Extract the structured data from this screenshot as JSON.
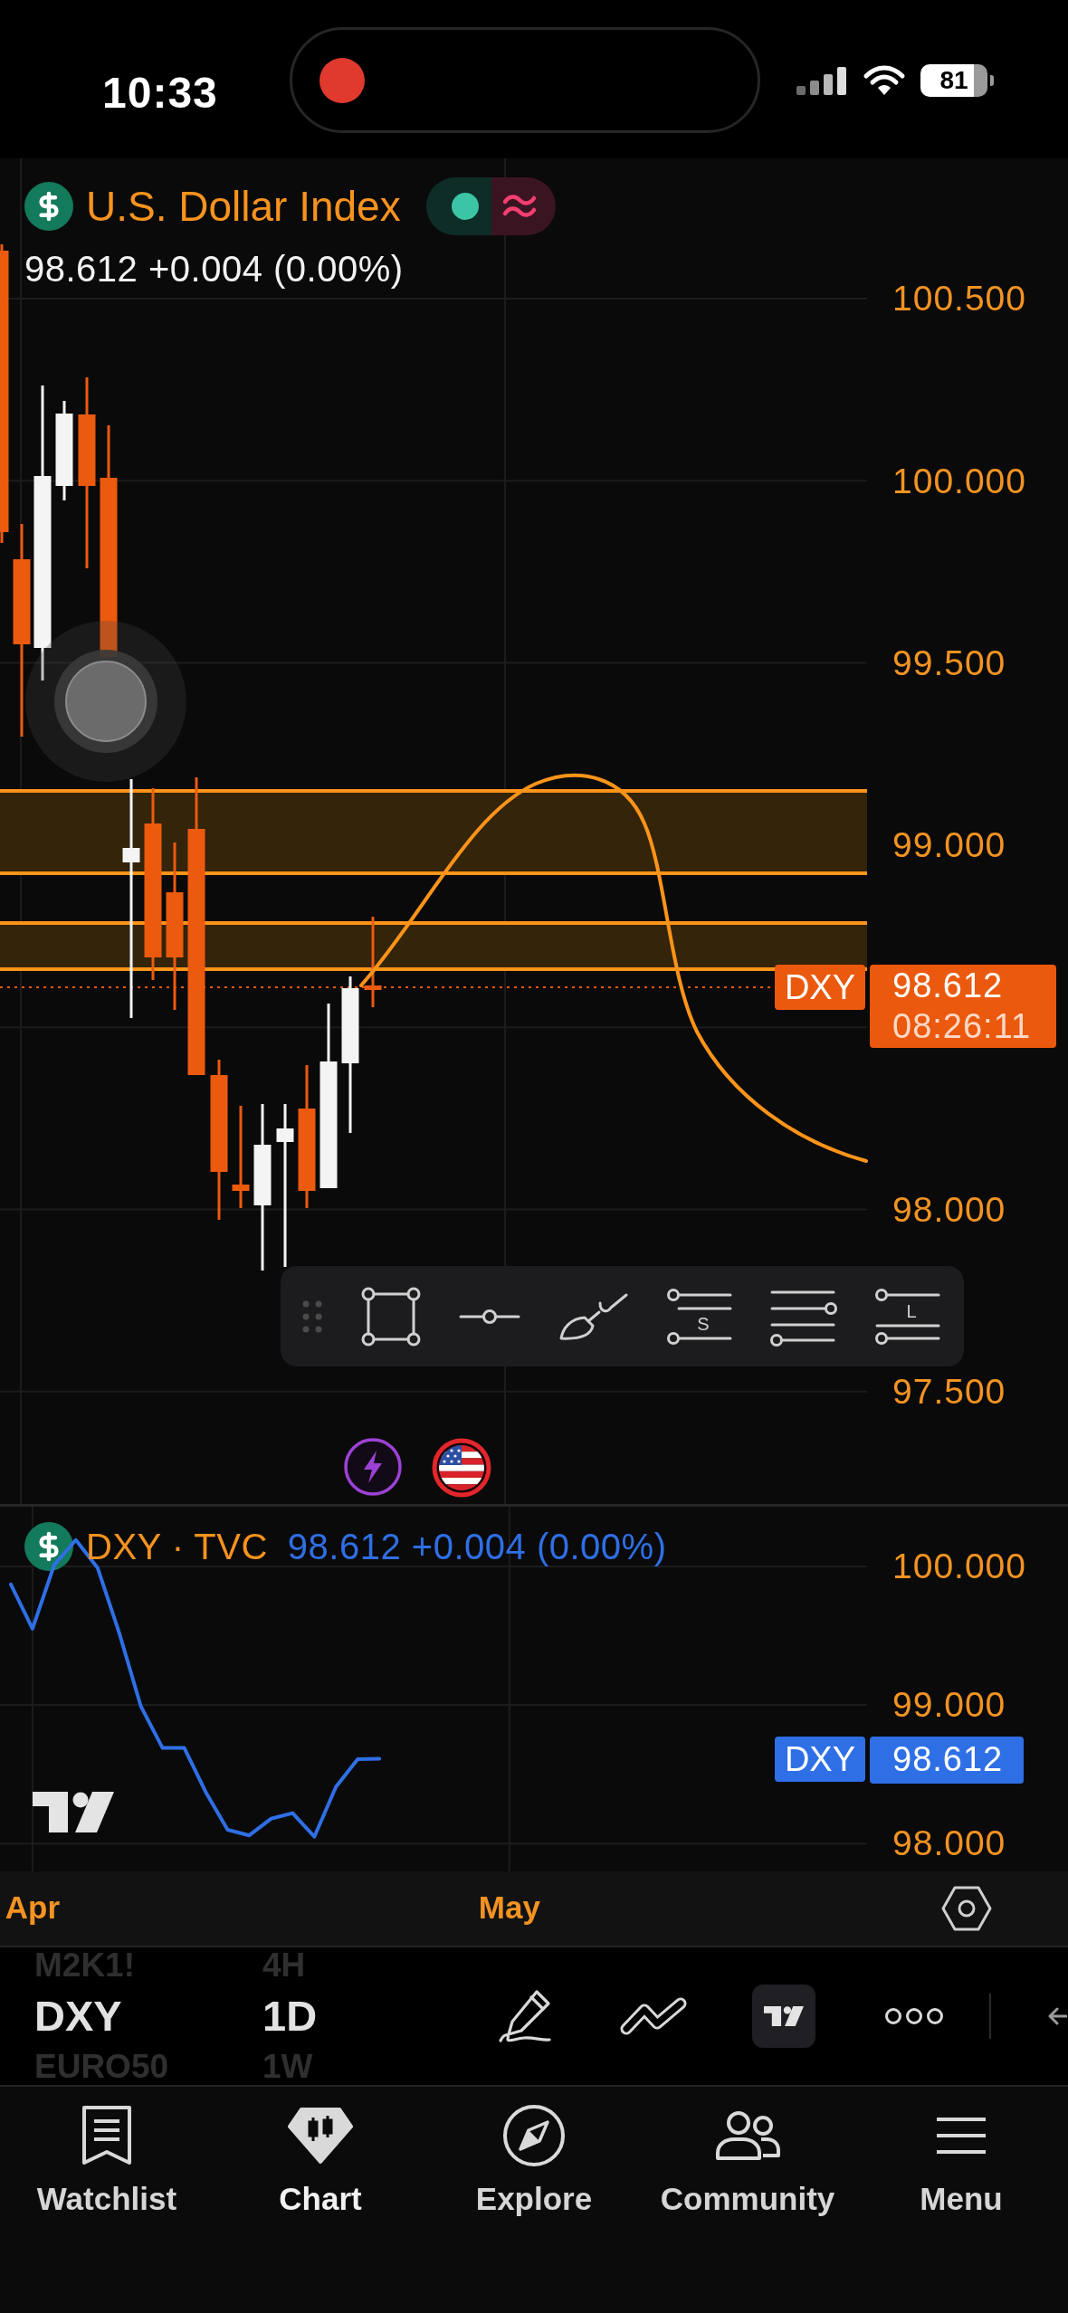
{
  "status_bar": {
    "time": "10:33",
    "battery": "81"
  },
  "main_chart": {
    "legend": {
      "title": "U.S. Dollar Index",
      "quote": "98.612 +0.004 (0.00%)"
    },
    "price_scale": [
      "100.500",
      "100.000",
      "99.500",
      "99.000",
      "98.000",
      "97.500"
    ],
    "price_tag": {
      "symbol": "DXY",
      "price": "98.612",
      "countdown": "08:26:11"
    },
    "drawing_toolbar": {
      "letters": [
        "S",
        "L"
      ]
    }
  },
  "compare_pane": {
    "legend": {
      "symbol": "DXY · TVC",
      "quote": "98.612 +0.004 (0.00%)"
    },
    "price_tag": {
      "price": "98.612"
    },
    "chart_data": {
      "type": "line",
      "grid": true,
      "categories": [
        null,
        "Apr",
        null,
        null,
        null,
        null,
        null,
        null,
        null,
        null,
        null,
        null,
        null,
        null,
        null,
        null,
        null,
        null,
        null,
        null,
        null,
        null,
        null,
        "May",
        null,
        null,
        null,
        null,
        null,
        null,
        null,
        null,
        null,
        null,
        null,
        null,
        null,
        null,
        null,
        null
      ],
      "series": [
        {
          "name": "DXY",
          "color": "#2f6fe6",
          "values": [
            99.87,
            99.55,
            100.01,
            100.19,
            99.99,
            99.52,
            98.99,
            98.69,
            98.69,
            98.37,
            98.1,
            98.06,
            98.18,
            98.22,
            98.05,
            98.41,
            98.61,
            98.612,
            null,
            null,
            null,
            null,
            null,
            null,
            null,
            null,
            null,
            null,
            null,
            null,
            null,
            null,
            null,
            null,
            null,
            null,
            null,
            null,
            null,
            null
          ]
        }
      ],
      "ylim": [
        97.8,
        100.43
      ],
      "yticks": [
        {
          "value": 100,
          "label": "100.000"
        },
        {
          "value": 99,
          "label": "99.000"
        },
        {
          "value": 98,
          "label": "98.000"
        }
      ]
    }
  },
  "toolbar": {
    "symbols": [
      {
        "label": "M2K1!",
        "selected": false
      },
      {
        "label": "DXY",
        "selected": true
      },
      {
        "label": "EURO50",
        "selected": false
      }
    ],
    "intervals": [
      {
        "label": "4H",
        "selected": false
      },
      {
        "label": "1D",
        "selected": true
      },
      {
        "label": "1W",
        "selected": false
      }
    ],
    "tools": [
      {
        "selected": false
      },
      {
        "selected": false
      },
      {
        "selected": true
      },
      {
        "selected": false
      }
    ]
  },
  "tab_bar": [
    {
      "label": "Watchlist",
      "selected": false
    },
    {
      "label": "Chart",
      "selected": true
    },
    {
      "label": "Explore",
      "selected": false
    },
    {
      "label": "Community",
      "selected": false
    },
    {
      "label": "Menu",
      "selected": false
    }
  ]
}
